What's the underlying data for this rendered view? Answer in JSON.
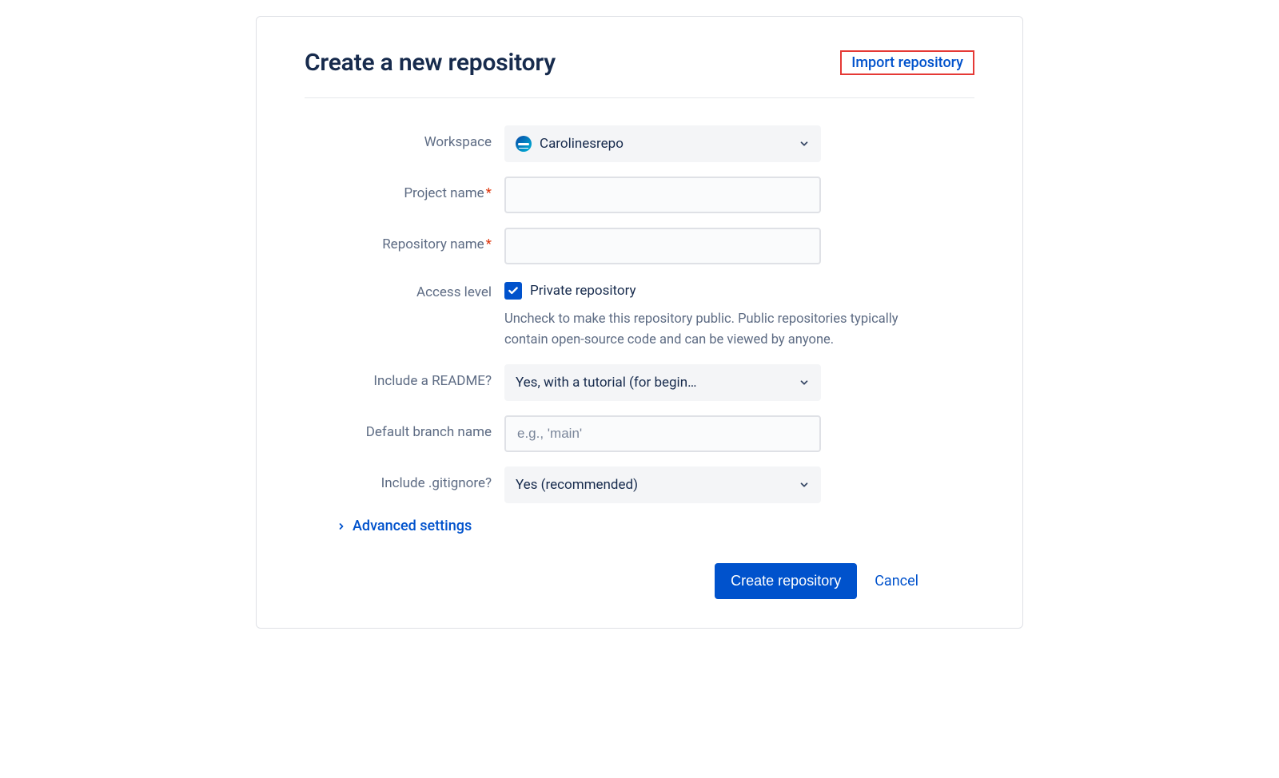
{
  "header": {
    "title": "Create a new repository",
    "import_link": "Import repository"
  },
  "fields": {
    "workspace": {
      "label": "Workspace",
      "value": "Carolinesrepo"
    },
    "project_name": {
      "label": "Project name",
      "value": ""
    },
    "repository_name": {
      "label": "Repository name",
      "value": ""
    },
    "access_level": {
      "label": "Access level",
      "checkbox_label": "Private repository",
      "checked": true,
      "hint": "Uncheck to make this repository public. Public repositories typically contain open-source code and can be viewed by anyone."
    },
    "include_readme": {
      "label": "Include a README?",
      "value": "Yes, with a tutorial (for begin…"
    },
    "default_branch": {
      "label": "Default branch name",
      "placeholder": "e.g., 'main'",
      "value": ""
    },
    "include_gitignore": {
      "label": "Include .gitignore?",
      "value": "Yes (recommended)"
    }
  },
  "advanced": {
    "label": "Advanced settings"
  },
  "footer": {
    "create": "Create repository",
    "cancel": "Cancel"
  }
}
